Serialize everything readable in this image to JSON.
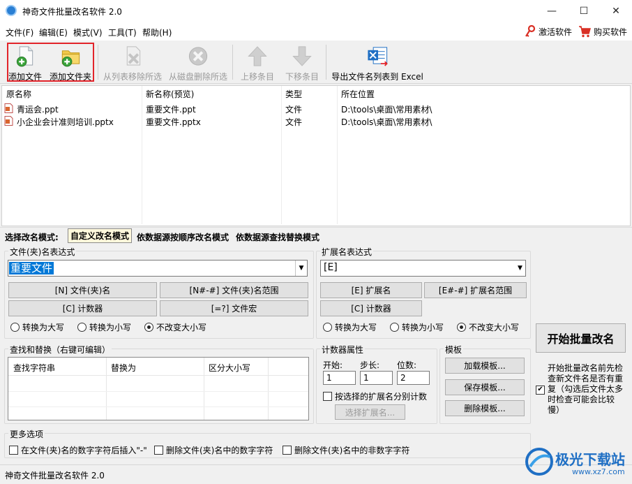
{
  "window": {
    "title": "神奇文件批量改名软件 2.0",
    "min": "—",
    "max": "☐",
    "close": "✕"
  },
  "menu": {
    "items": [
      "文件(F)",
      "编辑(E)",
      "模式(V)",
      "工具(T)",
      "帮助(H)"
    ],
    "activate": "激活软件",
    "buy": "购买软件"
  },
  "toolbar": {
    "add_file": "添加文件",
    "add_folder": "添加文件夹",
    "remove_list": "从列表移除所选",
    "remove_disk": "从磁盘删除所选",
    "move_up": "上移条目",
    "move_down": "下移条目",
    "export": "导出文件名列表到 Excel"
  },
  "filelist": {
    "columns": [
      "原名称",
      "新名称(预览)",
      "类型",
      "所在位置"
    ],
    "rows": [
      {
        "orig": "青运会.ppt",
        "new": "重要文件.ppt",
        "type": "文件",
        "path": "D:\\tools\\桌面\\常用素材\\"
      },
      {
        "orig": "小企业会计准则培训.pptx",
        "new": "重要文件.pptx",
        "type": "文件",
        "path": "D:\\tools\\桌面\\常用素材\\"
      }
    ]
  },
  "mode": {
    "label": "选择改名模式:",
    "tabs": [
      "自定义改名模式",
      "依数据源按顺序改名模式",
      "依数据源查找替换模式"
    ]
  },
  "name_expr": {
    "title": "文件(夹)名表达式",
    "value": "重要文件",
    "btn_name": "[N] 文件(夹)名",
    "btn_range": "[N#-#] 文件(夹)名范围",
    "btn_counter": "[C] 计数器",
    "btn_macro": "[=?] 文件宏",
    "upper": "转换为大写",
    "lower": "转换为小写",
    "keep": "不改变大小写"
  },
  "ext_expr": {
    "title": "扩展名表达式",
    "value": "[E]",
    "btn_ext": "[E] 扩展名",
    "btn_range": "[E#-#] 扩展名范围",
    "btn_counter": "[C] 计数器",
    "upper": "转换为大写",
    "lower": "转换为小写",
    "keep": "不改变大小写"
  },
  "find_replace": {
    "title": "查找和替换（右键可编辑）",
    "columns": [
      "查找字符串",
      "替换为",
      "区分大小写"
    ]
  },
  "counter": {
    "title": "计数器属性",
    "start_label": "开始:",
    "step_label": "步长:",
    "digits_label": "位数:",
    "start": "1",
    "step": "1",
    "digits": "2",
    "per_ext": "按选择的扩展名分别计数",
    "choose_ext": "选择扩展名..."
  },
  "template": {
    "title": "模板",
    "load": "加载模板...",
    "save": "保存模板...",
    "delete": "删除模板..."
  },
  "start": {
    "button": "开始批量改名",
    "check_line1": "开始批量改名前先检",
    "check_line2": "查新文件名是否有重",
    "check_line3": "复（勾选后文件太多",
    "check_line4": "时检查可能会比较",
    "check_line5": "慢）"
  },
  "more": {
    "title": "更多选项",
    "opt1": "在文件(夹)名的数字字符后插入\"-\"",
    "opt2": "删除文件(夹)名中的数字字符",
    "opt3": "删除文件(夹)名中的非数字字符"
  },
  "status": {
    "text": "神奇文件批量改名软件 2.0"
  },
  "watermark": {
    "text": "极光下载站",
    "url": "www.xz7.com"
  },
  "colors": {
    "highlight": "#e2242a",
    "accent": "#1f6fc4"
  }
}
